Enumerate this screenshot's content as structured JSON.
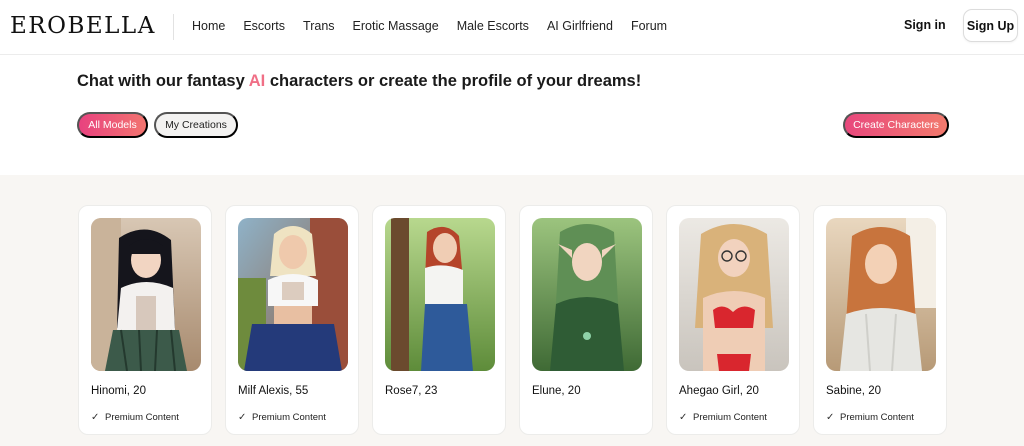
{
  "app": {
    "logo": "EROBELLA"
  },
  "nav": {
    "items": [
      "Home",
      "Escorts",
      "Trans",
      "Erotic Massage",
      "Male Escorts",
      "AI Girlfriend",
      "Forum"
    ],
    "active_index": 5
  },
  "auth": {
    "signin_label": "Sign in",
    "signup_label": "Sign Up"
  },
  "hero": {
    "headline_before": "Chat with our fantasy ",
    "headline_accent": "AI",
    "headline_after": " characters or create the profile of your dreams!"
  },
  "filters": {
    "all_models_label": "All Models",
    "my_creations_label": "My Creations"
  },
  "actions": {
    "create_label": "Create Characters"
  },
  "colors": {
    "accent": "#e8427f",
    "accent_end": "#f2746f",
    "nav_active": "#e0568a",
    "section_bg": "#f8f6f3"
  },
  "characters": [
    {
      "name": "Hinomi, 20",
      "badge": "Premium Content"
    },
    {
      "name": "Milf Alexis, 55",
      "badge": "Premium Content"
    },
    {
      "name": "Rose7, 23",
      "badge": ""
    },
    {
      "name": "Elune, 20",
      "badge": ""
    },
    {
      "name": "Ahegao Girl, 20",
      "badge": "Premium Content"
    },
    {
      "name": "Sabine, 20",
      "badge": "Premium Content"
    }
  ]
}
